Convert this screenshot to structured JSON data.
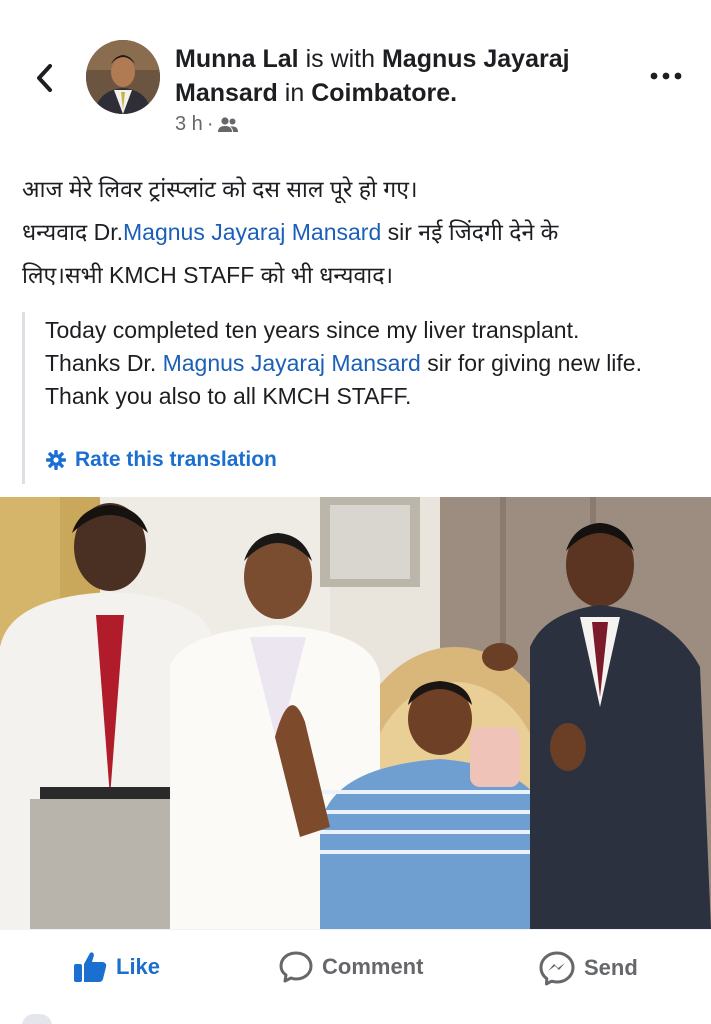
{
  "post": {
    "author": "Munna Lal",
    "with_text": "is with",
    "tagged": "Magnus Jayaraj Mansard",
    "in_text": "in",
    "location": "Coimbatore.",
    "time": "3 h",
    "separator": "·",
    "audience_icon": "friends-icon"
  },
  "text": {
    "line1": "आज मेरे लिवर ट्रांस्प्लांट को दस साल पूरे हो गए।",
    "line2_before": "धन्यवाद Dr.",
    "line2_link": "Magnus Jayaraj Mansard",
    "line2_after": " sir नई जिंदगी देने के",
    "line3": "लिए।सभी KMCH STAFF को भी धन्यवाद।"
  },
  "translation": {
    "part1": "Today completed ten years since my liver transplant.",
    "part2_before": "Thanks Dr. ",
    "part2_link": "Magnus Jayaraj Mansard",
    "part2_after": " sir for giving new life. Thank you also to all KMCH STAFF.",
    "rate_label": "Rate this translation",
    "rate_icon": "gear-icon"
  },
  "actions": {
    "like": "Like",
    "comment": "Comment",
    "send": "Send"
  },
  "colors": {
    "link": "#1b5fb8",
    "accent": "#1b6fd1",
    "muted": "#65676b"
  }
}
